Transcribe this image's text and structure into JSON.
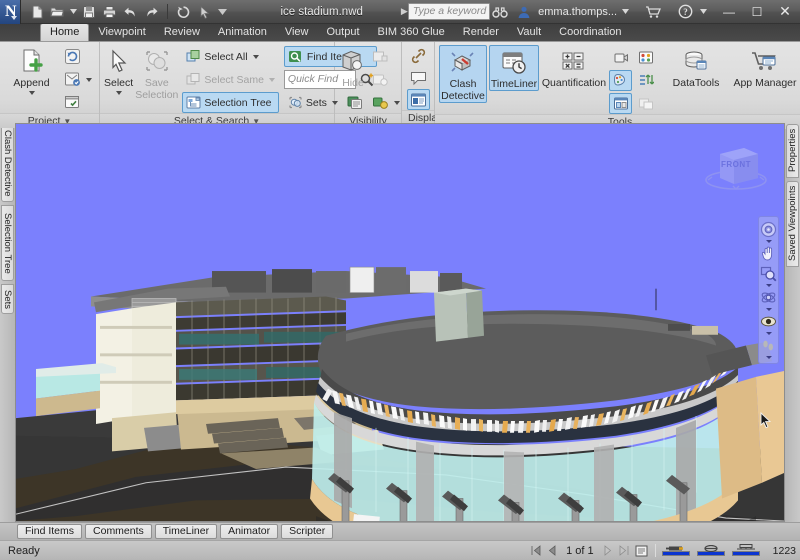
{
  "app": {
    "logo_letter": "N",
    "document_title": "ice stadium.nwd",
    "username": "emma.thomps...",
    "search_placeholder": "Type a keyword or phrase"
  },
  "quick_access": [
    {
      "name": "new-document",
      "icon": "page-icon"
    },
    {
      "name": "open-document",
      "icon": "folder-open-icon"
    },
    {
      "name": "open-dropdown",
      "icon": "chevron-down-icon"
    },
    {
      "name": "save",
      "icon": "floppy-disk-icon"
    },
    {
      "name": "print",
      "icon": "printer-icon"
    },
    {
      "name": "undo",
      "icon": "undo-arrow-icon"
    },
    {
      "name": "redo",
      "icon": "redo-arrow-icon"
    },
    {
      "name": "refresh",
      "icon": "refresh-icon"
    },
    {
      "name": "select-cursor",
      "icon": "arrow-cursor-icon"
    },
    {
      "name": "customize-qat",
      "icon": "chevron-down-icon"
    }
  ],
  "window_buttons": {
    "minimize": "—",
    "maximize": "☐",
    "close": "✕"
  },
  "ribbon": {
    "tabs": [
      {
        "label": "Home",
        "active": true
      },
      {
        "label": "Viewpoint",
        "active": false
      },
      {
        "label": "Review",
        "active": false
      },
      {
        "label": "Animation",
        "active": false
      },
      {
        "label": "View",
        "active": false
      },
      {
        "label": "Output",
        "active": false
      },
      {
        "label": "BIM 360 Glue",
        "active": false
      },
      {
        "label": "Render",
        "active": false
      },
      {
        "label": "Vault",
        "active": false
      },
      {
        "label": "Coordination",
        "active": false
      }
    ],
    "panels": {
      "project": {
        "label": "Project",
        "has_dropdown": true,
        "append": {
          "label": "Append",
          "has_menu": true
        },
        "small_buttons": [
          {
            "name": "refresh",
            "label": ""
          },
          {
            "name": "reset-all",
            "label": "",
            "has_menu": true
          },
          {
            "name": "file-options",
            "label": ""
          }
        ]
      },
      "select_search": {
        "label": "Select & Search",
        "has_dropdown": true,
        "select": {
          "label": "Select",
          "has_menu": true
        },
        "save_selection": {
          "label": "Save",
          "label2": "Selection",
          "disabled": true
        },
        "select_all": {
          "label": "Select All",
          "has_menu": true,
          "disabled": false
        },
        "select_same": {
          "label": "Select Same",
          "has_menu": true,
          "disabled": true
        },
        "selection_tree": {
          "label": "Selection Tree",
          "selected": true
        },
        "find_items": {
          "label": "Find Items",
          "selected": true
        },
        "quick_find": {
          "placeholder": "Quick Find"
        },
        "sets": {
          "label": "Sets",
          "has_menu": true
        }
      },
      "visibility": {
        "label": "Visibility",
        "hide": {
          "label": "Hide"
        },
        "small_buttons": [
          {
            "name": "require",
            "disabled": true
          },
          {
            "name": "hide-unselected",
            "disabled": true
          },
          {
            "name": "unhide-all",
            "has_menu": true
          }
        ]
      },
      "display": {
        "label": "Display",
        "buttons": [
          {
            "name": "links",
            "selected": false
          },
          {
            "name": "quick-properties",
            "selected": false
          },
          {
            "name": "properties",
            "selected": true
          }
        ]
      },
      "tools": {
        "label": "Tools",
        "clash_detective": {
          "label": "Clash",
          "label2": "Detective",
          "selected": true
        },
        "timeliner": {
          "label": "TimeLiner",
          "selected": true
        },
        "quantification": {
          "label": "Quantification"
        },
        "datatools": {
          "label": "DataTools"
        },
        "app_manager": {
          "label": "App Manager"
        },
        "small_buttons": [
          {
            "name": "animator"
          },
          {
            "name": "scripter"
          },
          {
            "name": "appearance-profiler",
            "selected": true
          },
          {
            "name": "batch-utility"
          },
          {
            "name": "compare",
            "selected": true
          },
          {
            "name": "switchback",
            "disabled": true
          }
        ]
      }
    }
  },
  "left_dock_tabs": [
    "Clash Detective",
    "Selection Tree",
    "Sets"
  ],
  "right_dock_tabs": [
    "Properties",
    "Saved Viewpoints"
  ],
  "viewport": {
    "view_cube_face": "FRONT",
    "sky_color": "#7b80fd",
    "ground_color": "#3a3a3a",
    "terrain_color": "#3d3527",
    "roof_color": "#5b5b5b",
    "glass_color": "#bfeeec",
    "facade_color": "#e8c893",
    "column_color": "#9a9a9a",
    "nav_items": [
      {
        "name": "steering-wheel",
        "icon": "wheel-icon"
      },
      {
        "name": "pan",
        "icon": "hand-icon"
      },
      {
        "name": "zoom-window",
        "icon": "magnifier-icon"
      },
      {
        "name": "orbit",
        "icon": "orbit-icon"
      },
      {
        "name": "look-around",
        "icon": "eye-icon"
      },
      {
        "name": "walk",
        "icon": "footprints-icon"
      }
    ]
  },
  "bottom_tabs": [
    "Find Items",
    "Comments",
    "TimeLiner",
    "Animator",
    "Scripter"
  ],
  "status": {
    "message": "Ready",
    "page_indicator": "1 of 1",
    "memory": "1223",
    "meters": [
      {
        "name": "pen-meter",
        "value": 100
      },
      {
        "name": "disk-meter",
        "value": 100
      },
      {
        "name": "web-meter",
        "value": 100
      }
    ]
  }
}
